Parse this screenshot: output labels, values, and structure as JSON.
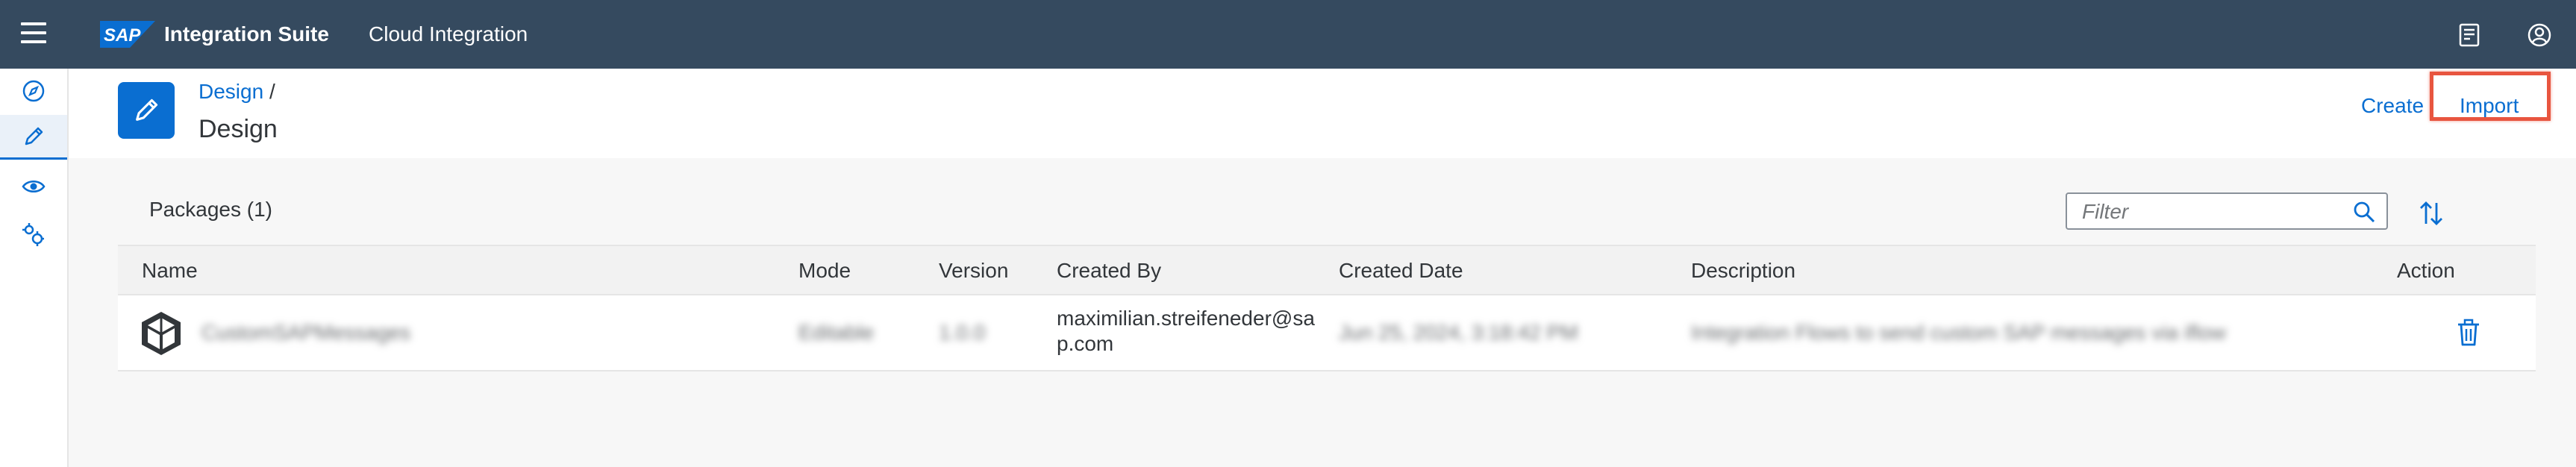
{
  "shell": {
    "brand": "SAP",
    "product_name": "Integration Suite",
    "product_sub": "Cloud Integration",
    "icons": [
      "menu-icon",
      "notes-icon",
      "user-icon"
    ]
  },
  "leftnav": {
    "items": [
      {
        "name": "discover",
        "icon": "compass-icon"
      },
      {
        "name": "design",
        "icon": "pencil-icon",
        "active": true
      },
      {
        "name": "monitor",
        "icon": "eye-icon"
      },
      {
        "name": "settings",
        "icon": "gears-icon"
      }
    ]
  },
  "header": {
    "breadcrumb_link": "Design",
    "breadcrumb_sep": "/",
    "title": "Design",
    "create_label": "Create",
    "import_label": "Import"
  },
  "packages": {
    "title": "Packages (1)",
    "filter_placeholder": "Filter",
    "columns": [
      "Name",
      "Mode",
      "Version",
      "Created By",
      "Created Date",
      "Description",
      "Action"
    ],
    "rows": [
      {
        "name": "CustomSAPMessages",
        "mode": "Editable",
        "version": "1.0.0",
        "created_by": "maximilian.streifeneder@sap.com",
        "created_date": "Jun 25, 2024, 3:18:42 PM",
        "description": "Integration Flows to send custom SAP messages via iflow"
      }
    ]
  },
  "colors": {
    "shell_bg": "#354a5f",
    "accent": "#0a6ed1",
    "highlight": "#e8553f"
  }
}
